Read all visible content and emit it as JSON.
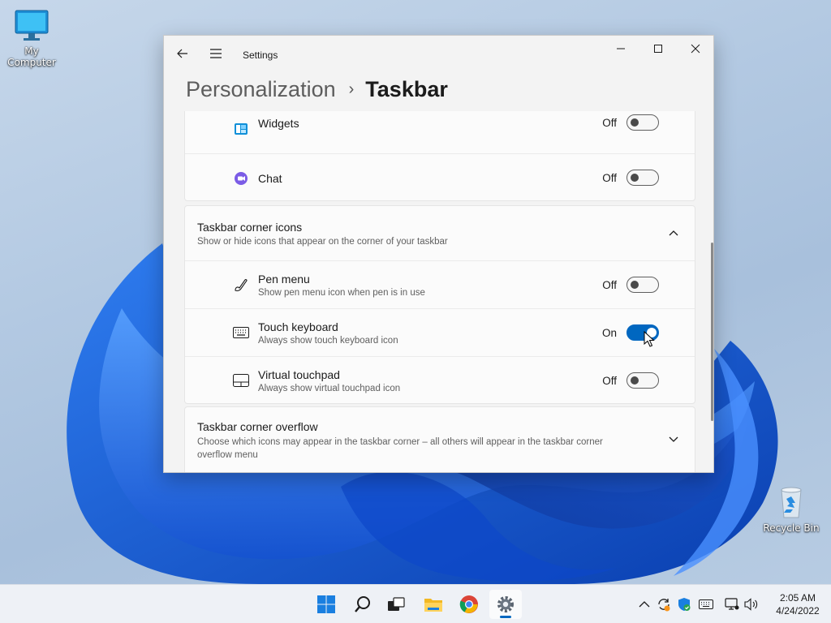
{
  "desktop": {
    "icons": [
      {
        "label": "My Computer",
        "icon": "computer-icon"
      },
      {
        "label": "Recycle Bin",
        "icon": "recycle-bin-icon"
      }
    ]
  },
  "window": {
    "app_title": "Settings",
    "breadcrumb": {
      "parent": "Personalization",
      "separator": "›",
      "current": "Taskbar"
    },
    "controls": [
      "minimize-icon",
      "maximize-icon",
      "close-icon"
    ]
  },
  "taskbar_items_card": {
    "rows": [
      {
        "label": "Widgets",
        "state": "Off",
        "on": false,
        "icon": "widgets-icon"
      },
      {
        "label": "Chat",
        "state": "Off",
        "on": false,
        "icon": "chat-icon"
      }
    ]
  },
  "corner_icons": {
    "title": "Taskbar corner icons",
    "subtitle": "Show or hide icons that appear on the corner of your taskbar",
    "expanded": true,
    "rows": [
      {
        "label": "Pen menu",
        "description": "Show pen menu icon when pen is in use",
        "state": "Off",
        "on": false,
        "icon": "pen-icon"
      },
      {
        "label": "Touch keyboard",
        "description": "Always show touch keyboard icon",
        "state": "On",
        "on": true,
        "icon": "keyboard-icon"
      },
      {
        "label": "Virtual touchpad",
        "description": "Always show virtual touchpad icon",
        "state": "Off",
        "on": false,
        "icon": "touchpad-icon"
      }
    ]
  },
  "corner_overflow": {
    "title": "Taskbar corner overflow",
    "subtitle": "Choose which icons may appear in the taskbar corner – all others will appear in the taskbar corner overflow menu",
    "expanded": false
  },
  "taskbar": {
    "apps": [
      "start-icon",
      "search-icon",
      "task-view-icon",
      "file-explorer-icon",
      "chrome-icon",
      "settings-icon"
    ],
    "active_app": "settings-icon",
    "tray": [
      "chevron-up-icon",
      "update-icon",
      "security-icon",
      "keyboard-icon",
      "network-icon",
      "volume-icon"
    ],
    "time": "2:05 AM",
    "date": "4/24/2022"
  },
  "colors": {
    "accent": "#0067c0",
    "window_bg": "#f3f3f3",
    "card_bg": "#fbfbfb"
  }
}
